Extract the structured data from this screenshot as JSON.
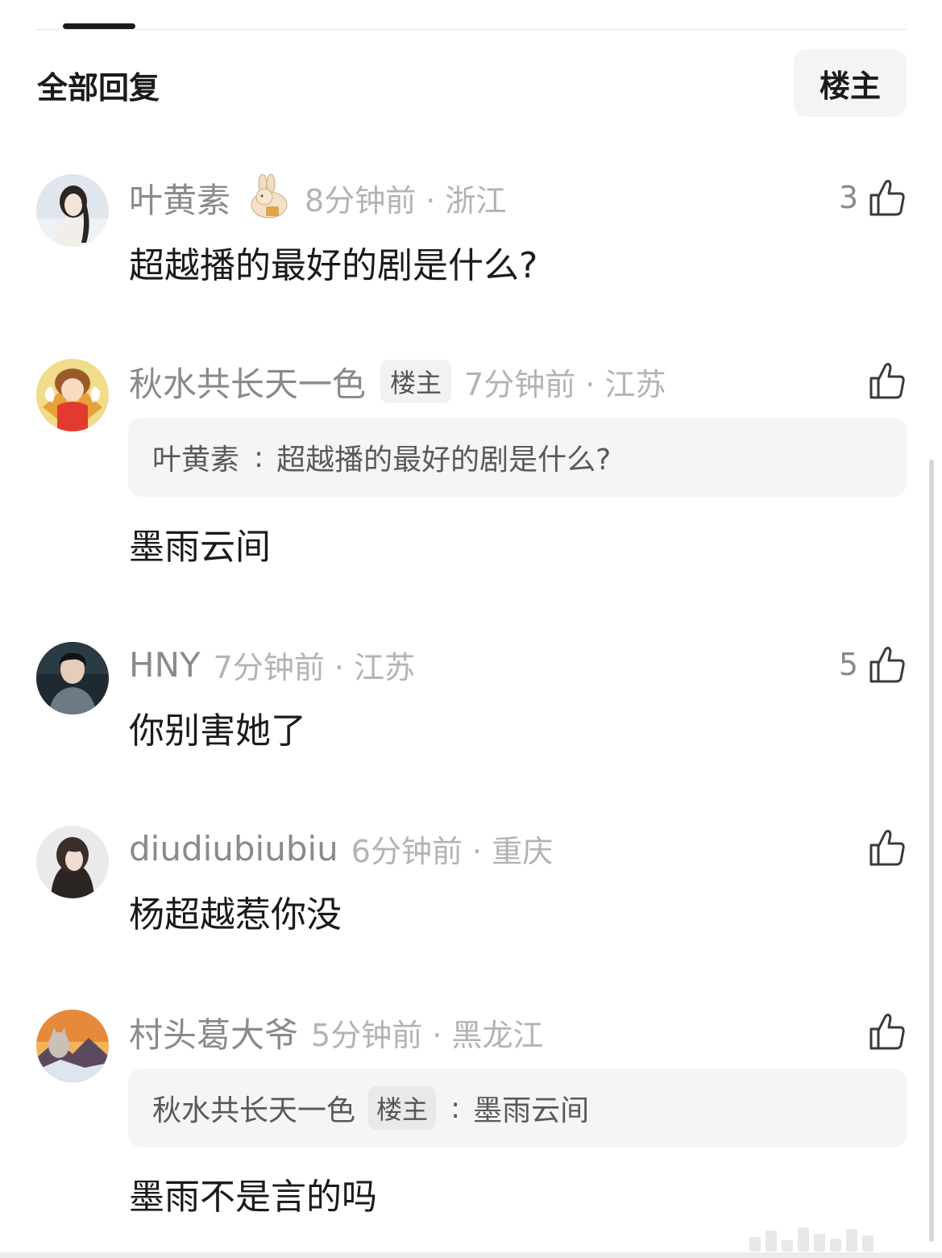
{
  "header": {
    "title": "全部回复",
    "op_filter_label": "楼主"
  },
  "comments": [
    {
      "username": "叶黄素",
      "time_location": "8分钟前 · 浙江",
      "has_emblem": true,
      "emblem_icon": "rabbit-emblem-icon",
      "like_count": "3",
      "text": "超越播的最好的剧是什么?"
    },
    {
      "username": "秋水共长天一色",
      "badge": "楼主",
      "time_location": "7分钟前 · 江苏",
      "like_count": "",
      "quote": {
        "author": "叶黄素",
        "separator": ":",
        "text": "超越播的最好的剧是什么?"
      },
      "text": "墨雨云间"
    },
    {
      "username": "HNY",
      "time_location": "7分钟前 · 江苏",
      "like_count": "5",
      "text": "你别害她了"
    },
    {
      "username": "diudiubiubiu",
      "time_location": "6分钟前 · 重庆",
      "like_count": "",
      "text": "杨超越惹你没"
    },
    {
      "username": "村头葛大爷",
      "time_location": "5分钟前 · 黑龙江",
      "like_count": "",
      "quote": {
        "author": "秋水共长天一色",
        "badge": "楼主",
        "separator": ":",
        "text": "墨雨云间"
      },
      "text": "墨雨不是言的吗"
    }
  ],
  "colors": {
    "username": "#8a8a8a",
    "meta": "#b3b3b3",
    "body_text": "#1a1a1a",
    "quote_bg": "#f5f5f5"
  }
}
